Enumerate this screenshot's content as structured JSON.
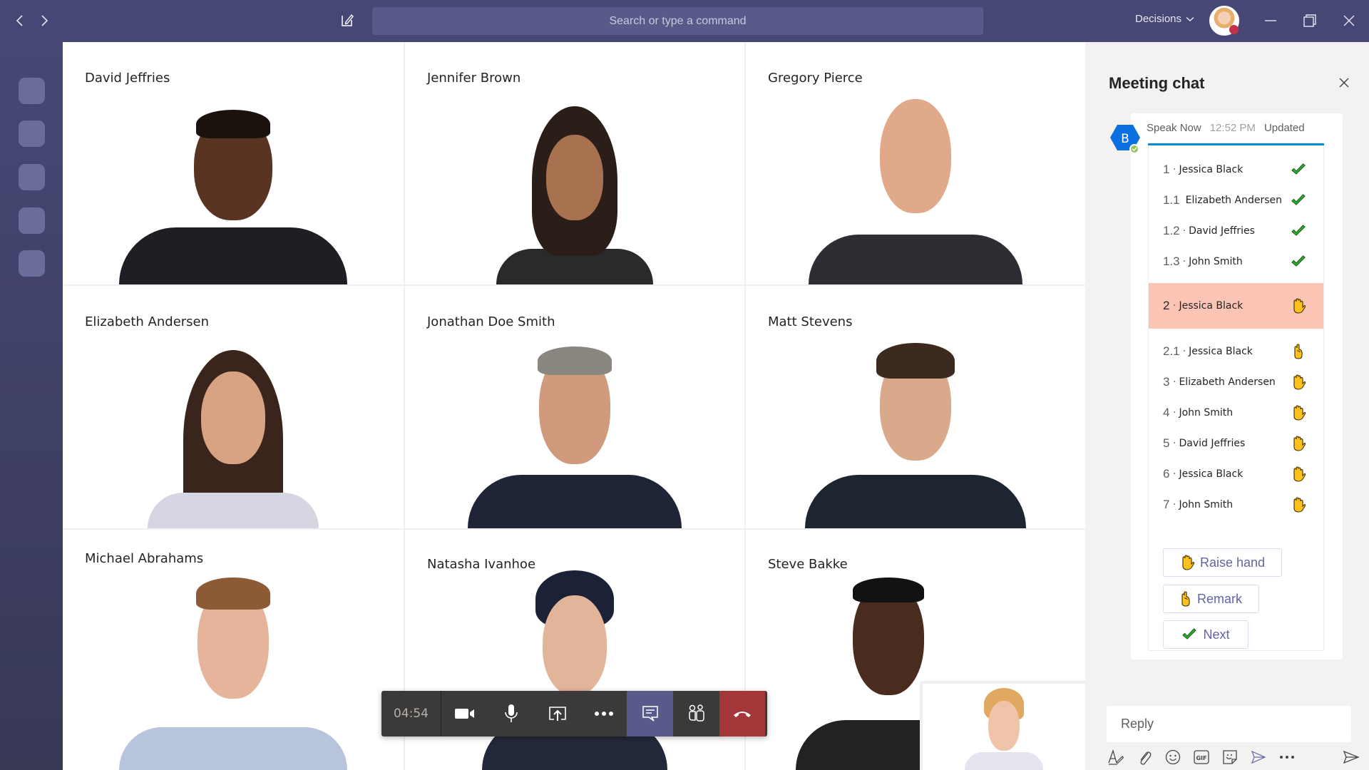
{
  "titlebar": {
    "search_placeholder": "Search or type a command",
    "org_dropdown": "Decisions",
    "icons": [
      "back-icon",
      "forward-icon",
      "compose-icon",
      "chevron-down-icon",
      "minimize-icon",
      "restore-icon",
      "close-icon"
    ],
    "presence_color": "#c4314b"
  },
  "rail": {
    "item_count": 5
  },
  "participants": [
    {
      "name": "David Jeffries"
    },
    {
      "name": "Jennifer Brown"
    },
    {
      "name": "Gregory Pierce"
    },
    {
      "name": "Elizabeth Andersen"
    },
    {
      "name": "Jonathan Doe Smith"
    },
    {
      "name": "Matt Stevens"
    },
    {
      "name": "Michael Abrahams"
    },
    {
      "name": "Natasha Ivanhoe"
    },
    {
      "name": "Steve Bakke"
    }
  ],
  "callbar": {
    "timer": "04:54",
    "buttons": [
      "camera",
      "microphone",
      "share-screen",
      "more-options",
      "chat",
      "participants",
      "hang-up"
    ],
    "active": "chat",
    "hangup_color": "#a4373a"
  },
  "chat": {
    "title": "Meeting chat",
    "message": {
      "avatar_initial": "B",
      "sender": "Speak Now",
      "time": "12:52 PM",
      "status": "Updated",
      "accent_color": "#0b8ed1",
      "queue": [
        {
          "num": "1",
          "sep": "·",
          "name": "Jessica Black",
          "icon": "check"
        },
        {
          "num": "1.1",
          "sep": "",
          "name": "Elizabeth Andersen",
          "icon": "check"
        },
        {
          "num": "1.2",
          "sep": "·",
          "name": "David Jeffries",
          "icon": "check"
        },
        {
          "num": "1.3",
          "sep": "·",
          "name": "John Smith",
          "icon": "check"
        },
        {
          "num": "2",
          "sep": "·",
          "name": "Jessica Black",
          "icon": "raised-hand",
          "current": true
        },
        {
          "num": "2.1",
          "sep": "·",
          "name": "Jessica Black",
          "icon": "remark-hand"
        },
        {
          "num": "3",
          "sep": "·",
          "name": "Elizabeth Andersen",
          "icon": "raised-hand"
        },
        {
          "num": "4",
          "sep": "·",
          "name": "John Smith",
          "icon": "raised-hand"
        },
        {
          "num": "5",
          "sep": "·",
          "name": "David Jeffries",
          "icon": "raised-hand"
        },
        {
          "num": "6",
          "sep": "·",
          "name": "Jessica Black",
          "icon": "raised-hand"
        },
        {
          "num": "7",
          "sep": "·",
          "name": "John Smith",
          "icon": "raised-hand"
        }
      ],
      "current_color": "#fbc4b4",
      "actions": [
        {
          "label": "Raise hand",
          "icon": "raised-hand"
        },
        {
          "label": "Remark",
          "icon": "remark-hand"
        },
        {
          "label": "Next",
          "icon": "check"
        }
      ]
    },
    "reply_placeholder": "Reply",
    "tools": [
      "format",
      "attach",
      "emoji",
      "gif",
      "sticker",
      "meet-now",
      "more",
      "send"
    ]
  }
}
